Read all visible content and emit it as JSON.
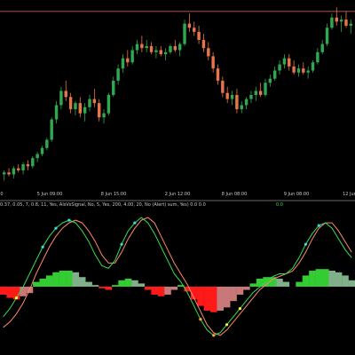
{
  "colors": {
    "background": "#000000",
    "bull_candle": "#2fa84f",
    "bear_candle": "#e8744a",
    "price_line": "#e8744a",
    "separator": "#8a8a8a",
    "hist_up": "#33cc33",
    "hist_down": "#ff1a1a",
    "hist_fade_up": "#7fb08a",
    "hist_fade_down": "#c87878",
    "main_line": "#33dd55",
    "signal_line": "#ff8866",
    "dot_cyan": "#33dddd",
    "dot_yellow": "#ffff33",
    "dot_orange": "#ffaa33"
  },
  "price_panel": {
    "time_labels": [
      {
        "text": "0",
        "pos": 0.005
      },
      {
        "text": "5 Jun 09:00",
        "pos": 0.14
      },
      {
        "text": "8 Jun 15:00",
        "pos": 0.32
      },
      {
        "text": "2 Jun 12:00",
        "pos": 0.5
      },
      {
        "text": "8 Jun 08:00",
        "pos": 0.66
      },
      {
        "text": "9 Jun 08:00",
        "pos": 0.835
      },
      {
        "text": "12 Jun",
        "pos": 0.985
      }
    ]
  },
  "indicator": {
    "params": "0.37, 0.05, 7, 0.8, 11, Yes, AlsVsSignal, No, 5, Yes, 200, 4.00, 20, No (Alert) sum, Yes) 0.0  0.0",
    "value": "0.0"
  },
  "chart_data": {
    "type": "candlestick",
    "candles": [
      [
        0.0,
        0.2,
        -0.3,
        0.1
      ],
      [
        0.1,
        0.3,
        -0.1,
        0.0
      ],
      [
        0.0,
        0.4,
        -0.2,
        0.3
      ],
      [
        0.3,
        0.5,
        0.1,
        0.2
      ],
      [
        0.2,
        0.6,
        0.0,
        0.5
      ],
      [
        0.5,
        0.7,
        0.2,
        0.4
      ],
      [
        0.4,
        0.9,
        0.3,
        0.8
      ],
      [
        0.8,
        1.1,
        0.6,
        1.0
      ],
      [
        1.0,
        1.4,
        0.9,
        1.3
      ],
      [
        1.3,
        1.8,
        1.2,
        1.7
      ],
      [
        1.7,
        2.8,
        1.6,
        2.7
      ],
      [
        2.7,
        3.6,
        2.5,
        3.4
      ],
      [
        3.4,
        4.3,
        3.2,
        4.1
      ],
      [
        4.1,
        4.6,
        3.6,
        3.8
      ],
      [
        3.8,
        4.0,
        3.0,
        3.2
      ],
      [
        3.2,
        3.6,
        2.9,
        3.5
      ],
      [
        3.5,
        3.8,
        2.8,
        3.0
      ],
      [
        3.0,
        3.5,
        2.6,
        3.3
      ],
      [
        3.3,
        3.9,
        3.1,
        3.7
      ],
      [
        3.7,
        4.2,
        3.3,
        3.5
      ],
      [
        3.5,
        3.7,
        2.6,
        2.8
      ],
      [
        2.8,
        3.2,
        2.5,
        3.0
      ],
      [
        3.0,
        4.0,
        2.9,
        3.9
      ],
      [
        3.9,
        4.8,
        3.8,
        4.6
      ],
      [
        4.6,
        5.4,
        4.4,
        5.2
      ],
      [
        5.2,
        5.9,
        5.0,
        5.7
      ],
      [
        5.7,
        6.1,
        5.3,
        5.5
      ],
      [
        5.5,
        6.3,
        5.4,
        6.1
      ],
      [
        6.1,
        6.6,
        5.9,
        6.4
      ],
      [
        6.4,
        6.8,
        6.0,
        6.2
      ],
      [
        6.2,
        6.6,
        6.0,
        6.3
      ],
      [
        6.3,
        6.5,
        5.9,
        6.0
      ],
      [
        6.0,
        6.3,
        5.7,
        6.1
      ],
      [
        6.1,
        6.3,
        5.8,
        5.9
      ],
      [
        5.9,
        6.2,
        5.6,
        6.0
      ],
      [
        6.0,
        6.4,
        5.9,
        6.3
      ],
      [
        6.3,
        6.6,
        6.0,
        6.1
      ],
      [
        6.1,
        6.5,
        5.8,
        6.4
      ],
      [
        6.4,
        7.6,
        6.3,
        7.4
      ],
      [
        7.4,
        7.9,
        7.0,
        7.2
      ],
      [
        7.2,
        7.5,
        6.8,
        7.0
      ],
      [
        7.0,
        7.3,
        6.4,
        6.6
      ],
      [
        6.6,
        6.9,
        6.0,
        6.2
      ],
      [
        6.2,
        6.5,
        5.6,
        5.8
      ],
      [
        5.8,
        6.0,
        5.0,
        5.2
      ],
      [
        5.2,
        5.4,
        4.4,
        4.6
      ],
      [
        4.6,
        4.8,
        3.8,
        4.0
      ],
      [
        4.0,
        4.3,
        3.5,
        3.7
      ],
      [
        3.7,
        4.1,
        3.4,
        3.9
      ],
      [
        3.9,
        4.2,
        3.0,
        3.2
      ],
      [
        3.2,
        3.6,
        3.0,
        3.4
      ],
      [
        3.4,
        3.8,
        3.2,
        3.7
      ],
      [
        3.7,
        4.1,
        3.5,
        3.9
      ],
      [
        3.9,
        4.3,
        3.6,
        4.1
      ],
      [
        4.1,
        4.5,
        3.8,
        3.9
      ],
      [
        3.9,
        4.7,
        3.8,
        4.5
      ],
      [
        4.5,
        4.9,
        4.3,
        4.7
      ],
      [
        4.7,
        5.3,
        4.6,
        5.1
      ],
      [
        5.1,
        5.6,
        4.9,
        5.4
      ],
      [
        5.4,
        5.9,
        5.2,
        5.7
      ],
      [
        5.7,
        5.9,
        5.1,
        5.3
      ],
      [
        5.3,
        5.6,
        4.9,
        5.0
      ],
      [
        5.0,
        5.4,
        4.8,
        5.2
      ],
      [
        5.2,
        5.5,
        4.9,
        5.0
      ],
      [
        5.0,
        5.3,
        4.7,
        5.1
      ],
      [
        5.1,
        5.6,
        5.0,
        5.5
      ],
      [
        5.5,
        6.2,
        5.4,
        6.0
      ],
      [
        6.0,
        6.6,
        5.9,
        6.4
      ],
      [
        6.4,
        7.4,
        6.3,
        7.2
      ],
      [
        7.2,
        7.9,
        7.1,
        7.7
      ],
      [
        7.7,
        8.2,
        7.3,
        7.5
      ],
      [
        7.5,
        7.8,
        7.0,
        7.6
      ],
      [
        7.6,
        8.0,
        7.2,
        7.3
      ],
      [
        7.3,
        7.6,
        6.9,
        7.4
      ]
    ],
    "level_line": 8.0,
    "ylim": [
      -0.5,
      8.3
    ],
    "histogram": [
      -0.5,
      -0.7,
      -0.8,
      -0.6,
      -0.4,
      0.3,
      0.5,
      0.7,
      0.9,
      1.0,
      1.0,
      0.9,
      0.6,
      0.3,
      0.1,
      -0.1,
      -0.2,
      0.1,
      0.4,
      0.5,
      0.4,
      0.2,
      -0.2,
      -0.5,
      -0.6,
      -0.5,
      -0.2,
      0.1,
      -0.3,
      -0.8,
      -1.2,
      -1.5,
      -1.6,
      -1.5,
      -1.3,
      -0.9,
      -0.5,
      -0.2,
      0.2,
      0.5,
      0.6,
      0.6,
      0.5,
      0.3,
      0.0,
      0.3,
      0.7,
      1.0,
      1.1,
      1.1,
      1.0,
      0.9,
      0.7,
      0.4
    ],
    "hist_ylim": [
      -2.0,
      2.0
    ],
    "main_line": [
      -1.3,
      -1.0,
      -0.6,
      -0.2,
      0.3,
      0.8,
      1.3,
      1.7,
      2.0,
      2.2,
      2.3,
      2.2,
      1.9,
      1.5,
      1.0,
      0.6,
      0.5,
      0.8,
      1.4,
      1.9,
      2.2,
      2.4,
      2.2,
      1.8,
      1.3,
      0.8,
      0.3,
      0.0,
      -0.4,
      -0.9,
      -1.4,
      -1.8,
      -2.0,
      -1.9,
      -1.6,
      -1.3,
      -1.0,
      -0.7,
      -0.4,
      -0.2,
      0.0,
      0.2,
      0.3,
      0.3,
      0.5,
      0.9,
      1.4,
      1.8,
      2.1,
      2.2,
      2.0,
      1.6,
      1.2,
      0.9
    ],
    "signal_line": [
      -1.7,
      -1.5,
      -1.2,
      -0.8,
      -0.3,
      0.3,
      0.8,
      1.3,
      1.7,
      2.0,
      2.2,
      2.3,
      2.2,
      1.9,
      1.5,
      1.0,
      0.7,
      0.7,
      1.1,
      1.6,
      2.0,
      2.3,
      2.4,
      2.2,
      1.7,
      1.2,
      0.7,
      0.3,
      -0.1,
      -0.6,
      -1.1,
      -1.6,
      -1.9,
      -2.0,
      -1.8,
      -1.5,
      -1.2,
      -0.9,
      -0.6,
      -0.3,
      -0.1,
      0.1,
      0.2,
      0.3,
      0.4,
      0.7,
      1.1,
      1.6,
      2.0,
      2.2,
      2.2,
      1.9,
      1.5,
      1.1
    ],
    "ind_ylim": [
      -2.6,
      2.7
    ]
  }
}
